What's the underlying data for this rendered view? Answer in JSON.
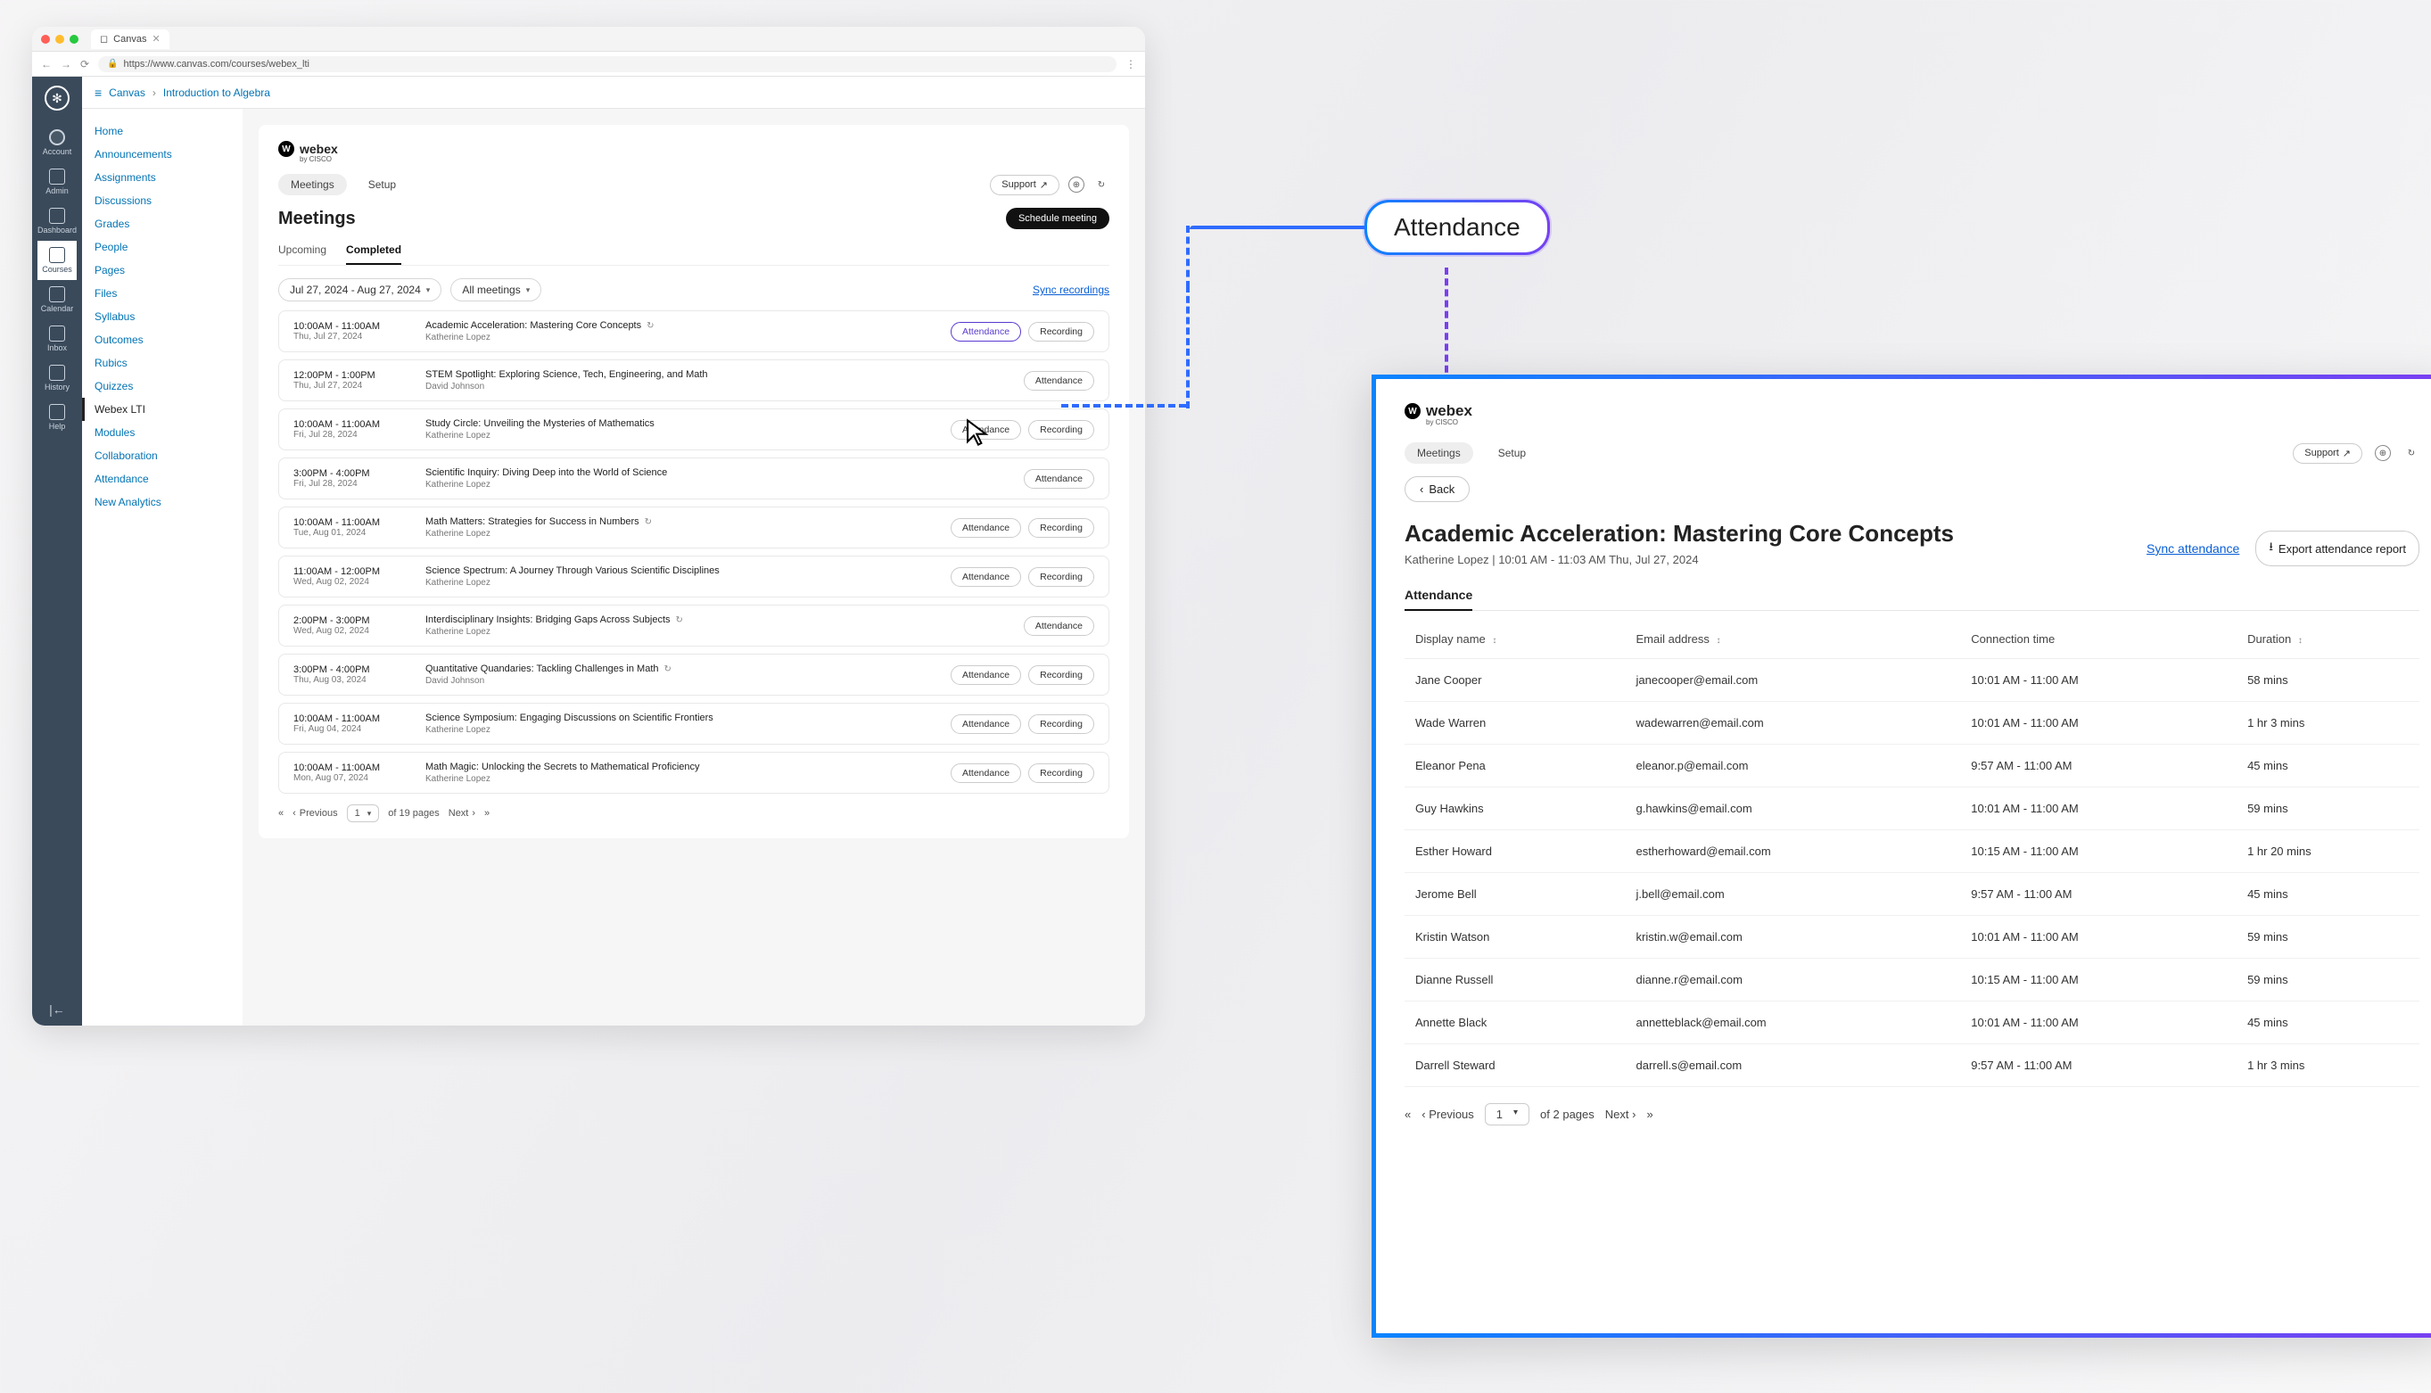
{
  "browser": {
    "tab_title": "Canvas",
    "url": "https://www.canvas.com/courses/webex_lti"
  },
  "rail": {
    "items": [
      "Account",
      "Admin",
      "Dashboard",
      "Courses",
      "Calendar",
      "Inbox",
      "History",
      "Help"
    ],
    "active": "Courses"
  },
  "breadcrumb": {
    "root": "Canvas",
    "course": "Introduction to Algebra"
  },
  "course_nav": {
    "items": [
      "Home",
      "Announcements",
      "Assignments",
      "Discussions",
      "Grades",
      "People",
      "Pages",
      "Files",
      "Syllabus",
      "Outcomes",
      "Rubics",
      "Quizzes",
      "Webex LTI",
      "Modules",
      "Collaboration",
      "Attendance",
      "New Analytics"
    ],
    "active": "Webex LTI"
  },
  "webex": {
    "brand": "webex",
    "brand_sub": "by CISCO",
    "tabs": {
      "meetings": "Meetings",
      "setup": "Setup"
    },
    "support": "Support",
    "heading": "Meetings",
    "schedule_btn": "Schedule meeting",
    "subtabs": {
      "upcoming": "Upcoming",
      "completed": "Completed"
    },
    "filters": {
      "range": "Jul 27, 2024 - Aug 27, 2024",
      "type": "All meetings"
    },
    "sync_recordings": "Sync recordings",
    "buttons": {
      "attendance": "Attendance",
      "recording": "Recording"
    },
    "meetings": [
      {
        "time": "10:00AM - 11:00AM",
        "date": "Thu, Jul 27, 2024",
        "title": "Academic Acceleration: Mastering Core Concepts",
        "host": "Katherine Lopez",
        "recurring": true,
        "buttons": [
          "attendance",
          "recording"
        ],
        "highlight": true
      },
      {
        "time": "12:00PM - 1:00PM",
        "date": "Thu, Jul 27, 2024",
        "title": "STEM Spotlight: Exploring Science, Tech, Engineering, and Math",
        "host": "David Johnson",
        "recurring": false,
        "buttons": [
          "attendance"
        ]
      },
      {
        "time": "10:00AM - 11:00AM",
        "date": "Fri, Jul 28, 2024",
        "title": "Study Circle: Unveiling the Mysteries of Mathematics",
        "host": "Katherine Lopez",
        "recurring": false,
        "buttons": [
          "attendance",
          "recording"
        ]
      },
      {
        "time": "3:00PM - 4:00PM",
        "date": "Fri, Jul 28, 2024",
        "title": "Scientific Inquiry: Diving Deep into the World of Science",
        "host": "Katherine Lopez",
        "recurring": false,
        "buttons": [
          "attendance"
        ]
      },
      {
        "time": "10:00AM - 11:00AM",
        "date": "Tue, Aug 01, 2024",
        "title": "Math Matters: Strategies for Success in Numbers",
        "host": "Katherine Lopez",
        "recurring": true,
        "buttons": [
          "attendance",
          "recording"
        ]
      },
      {
        "time": "11:00AM - 12:00PM",
        "date": "Wed, Aug 02, 2024",
        "title": "Science Spectrum: A Journey Through Various Scientific Disciplines",
        "host": "Katherine Lopez",
        "recurring": false,
        "buttons": [
          "attendance",
          "recording"
        ]
      },
      {
        "time": "2:00PM - 3:00PM",
        "date": "Wed, Aug 02, 2024",
        "title": "Interdisciplinary Insights: Bridging Gaps Across Subjects",
        "host": "Katherine Lopez",
        "recurring": true,
        "buttons": [
          "attendance"
        ]
      },
      {
        "time": "3:00PM - 4:00PM",
        "date": "Thu, Aug 03, 2024",
        "title": "Quantitative Quandaries: Tackling Challenges in Math",
        "host": "David Johnson",
        "recurring": true,
        "buttons": [
          "attendance",
          "recording"
        ]
      },
      {
        "time": "10:00AM - 11:00AM",
        "date": "Fri, Aug 04, 2024",
        "title": "Science Symposium: Engaging Discussions on Scientific Frontiers",
        "host": "Katherine Lopez",
        "recurring": false,
        "buttons": [
          "attendance",
          "recording"
        ]
      },
      {
        "time": "10:00AM - 11:00AM",
        "date": "Mon, Aug 07, 2024",
        "title": "Math Magic: Unlocking the Secrets to Mathematical Proficiency",
        "host": "Katherine Lopez",
        "recurring": false,
        "buttons": [
          "attendance",
          "recording"
        ]
      }
    ],
    "pager": {
      "prev": "Previous",
      "next": "Next",
      "page": "1",
      "total": "of 19 pages"
    }
  },
  "callout_label": "Attendance",
  "detail": {
    "tabs": {
      "meetings": "Meetings",
      "setup": "Setup"
    },
    "support": "Support",
    "back": "Back",
    "title": "Academic Acceleration: Mastering Core Concepts",
    "subtitle": "Katherine Lopez | 10:01 AM - 11:03 AM Thu, Jul 27, 2024",
    "sync": "Sync attendance",
    "export": "Export attendance report",
    "tab_label": "Attendance",
    "columns": {
      "name": "Display name",
      "email": "Email address",
      "time": "Connection time",
      "dur": "Duration"
    },
    "rows": [
      {
        "name": "Jane Cooper",
        "email": "janecooper@email.com",
        "time": "10:01 AM - 11:00 AM",
        "dur": "58 mins"
      },
      {
        "name": "Wade Warren",
        "email": "wadewarren@email.com",
        "time": "10:01 AM - 11:00 AM",
        "dur": "1 hr 3 mins"
      },
      {
        "name": "Eleanor Pena",
        "email": "eleanor.p@email.com",
        "time": "9:57 AM - 11:00 AM",
        "dur": "45 mins"
      },
      {
        "name": "Guy Hawkins",
        "email": "g.hawkins@email.com",
        "time": "10:01 AM - 11:00 AM",
        "dur": "59 mins"
      },
      {
        "name": "Esther Howard",
        "email": "estherhoward@email.com",
        "time": "10:15 AM - 11:00 AM",
        "dur": "1 hr 20 mins"
      },
      {
        "name": "Jerome Bell",
        "email": "j.bell@email.com",
        "time": "9:57 AM - 11:00 AM",
        "dur": "45 mins"
      },
      {
        "name": "Kristin Watson",
        "email": "kristin.w@email.com",
        "time": "10:01 AM - 11:00 AM",
        "dur": "59 mins"
      },
      {
        "name": "Dianne Russell",
        "email": "dianne.r@email.com",
        "time": "10:15 AM - 11:00 AM",
        "dur": "59 mins"
      },
      {
        "name": "Annette Black",
        "email": "annetteblack@email.com",
        "time": "10:01 AM - 11:00 AM",
        "dur": "45 mins"
      },
      {
        "name": "Darrell Steward",
        "email": "darrell.s@email.com",
        "time": "9:57 AM - 11:00 AM",
        "dur": "1 hr 3 mins"
      }
    ],
    "pager": {
      "prev": "Previous",
      "next": "Next",
      "page": "1",
      "total": "of 2 pages"
    }
  }
}
